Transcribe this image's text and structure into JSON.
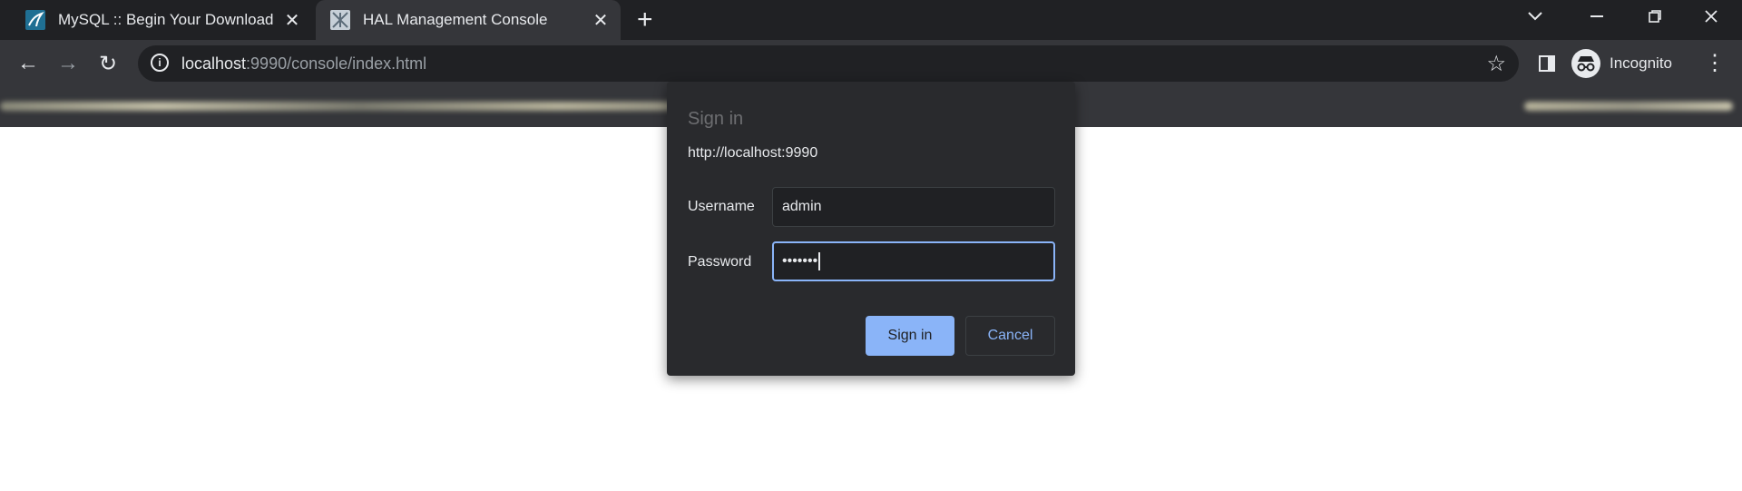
{
  "tabs": [
    {
      "title": "MySQL :: Begin Your Download",
      "icon": "mysql-dolphin-icon",
      "active": false
    },
    {
      "title": "HAL Management Console",
      "icon": "hal-console-icon",
      "active": true
    }
  ],
  "new_tab_glyph": "+",
  "window_controls": {
    "dropdown": "⌄",
    "minimize": "—",
    "restore": "❐",
    "close": "✕"
  },
  "toolbar": {
    "back": "←",
    "forward": "→",
    "reload": "↻",
    "url_host": "localhost",
    "url_rest": ":9990/console/index.html",
    "star": "☆",
    "incognito_label": "Incognito",
    "menu": "⋮"
  },
  "dialog": {
    "title": "Sign in",
    "origin": "http://localhost:9990",
    "username_label": "Username",
    "username_value": "admin",
    "password_label": "Password",
    "password_value": "•••••••",
    "sign_in_label": "Sign in",
    "cancel_label": "Cancel"
  },
  "colors": {
    "tabstrip": "#202124",
    "toolbar": "#35363a",
    "dialog": "#292a2d",
    "accent": "#8ab4f8"
  }
}
